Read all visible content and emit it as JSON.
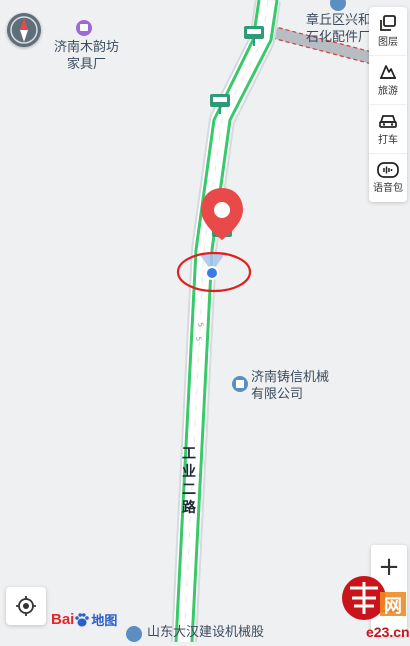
{
  "pois": [
    {
      "name_line1": "济南木韵坊",
      "name_line2": "家具厂"
    },
    {
      "name_line1": "章丘区兴和",
      "name_line2": "石化配件厂"
    },
    {
      "name_line1": "济南铸信机械",
      "name_line2": "有限公司"
    },
    {
      "name_line1": "山东大汉建设机械股",
      "name_line2": ""
    }
  ],
  "road": {
    "name_chars": [
      "工",
      "业",
      "二",
      "路"
    ]
  },
  "side_panel": {
    "items": [
      {
        "label": "图层",
        "icon": "layers-icon"
      },
      {
        "label": "旅游",
        "icon": "travel-icon"
      },
      {
        "label": "打车",
        "icon": "taxi-icon"
      },
      {
        "label": "语音包",
        "icon": "voice-pack-icon"
      }
    ]
  },
  "zoom": {
    "in_label": "+",
    "out_label": "−"
  },
  "logo": {
    "brand": "Bai",
    "brand2": "du",
    "map": "地图"
  },
  "watermark": {
    "text": "e23.cn",
    "glyph": "网"
  },
  "colors": {
    "road_green": "#37c96a",
    "marker_red": "#e84a4a",
    "location_blue": "#3a7be8",
    "annotation_red": "#e21f1f",
    "poi_purple": "#9b6bd6",
    "poi_blue": "#5b8fc4"
  }
}
